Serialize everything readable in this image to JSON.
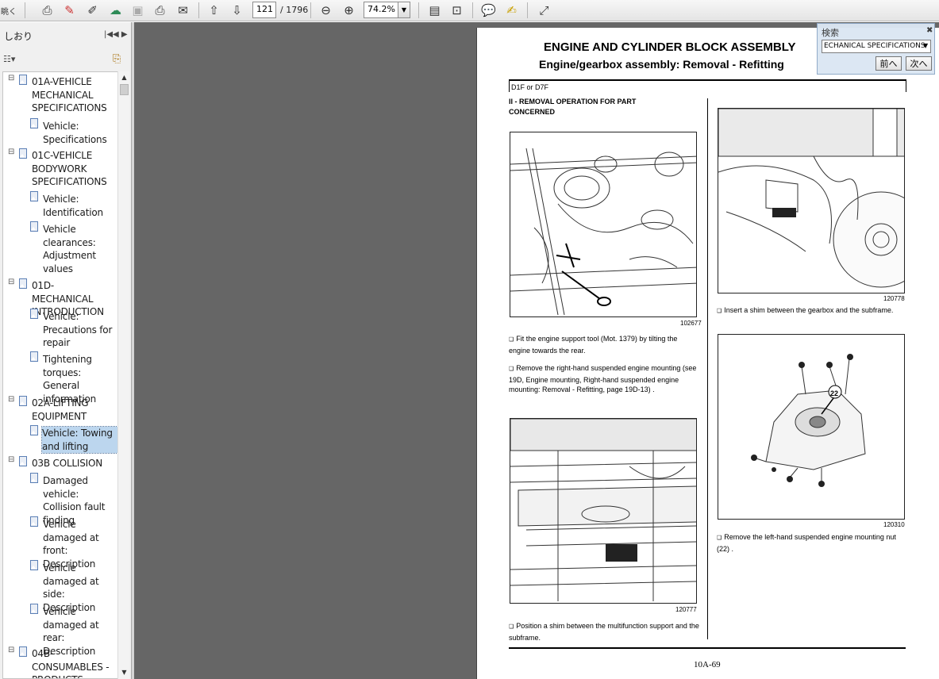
{
  "toolbar": {
    "page_current": "121",
    "page_total": "/ 1796",
    "zoom": "74.2%"
  },
  "sidebar": {
    "title": "しおり",
    "controls": "|◀◀ ▶",
    "items": [
      {
        "label": "01A-VEHICLE MECHANICAL SPECIFICATIONS"
      },
      {
        "label": "Vehicle: Specifications"
      },
      {
        "label": "01C-VEHICLE BODYWORK SPECIFICATIONS"
      },
      {
        "label": "Vehicle: Identification"
      },
      {
        "label": "Vehicle clearances: Adjustment values"
      },
      {
        "label": "01D-MECHANICAL INTRODUCTION"
      },
      {
        "label": "Vehicle: Precautions for repair"
      },
      {
        "label": "Tightening torques: General information"
      },
      {
        "label": "02A-LIFTING EQUIPMENT"
      },
      {
        "label": "Vehicle: Towing and lifting"
      },
      {
        "label": "03B COLLISION"
      },
      {
        "label": "Damaged vehicle: Collision fault finding"
      },
      {
        "label": "Vehicle damaged at front: Description"
      },
      {
        "label": "Vehicle damaged at side: Description"
      },
      {
        "label": "Vehicle damaged at rear: Description"
      },
      {
        "label": "04B-CONSUMABLES - PRODUCTS"
      }
    ]
  },
  "page": {
    "title": "ENGINE AND CYLINDER BLOCK ASSEMBLY",
    "subtitle": "Engine/gearbox assembly: Removal - Refitting",
    "engine_code": "D1F or D7F",
    "section_heading": "II - REMOVAL OPERATION FOR PART CONCERNED",
    "step1": "Fit the engine support tool (Mot. 1379) by tilting the engine towards the rear.",
    "step2": "Remove the right-hand suspended engine mounting (see 19D, Engine mounting, Right-hand suspended engine mounting: Removal - Refitting, page 19D-13) .",
    "step3": "Position a shim between the multifunction support and the subframe.",
    "step4": "Insert a shim between the gearbox and the subframe.",
    "step5": "Remove the left-hand suspended engine mounting nut (22) .",
    "fig1_num": "102677",
    "fig2_num": "120777",
    "fig3_num": "120778",
    "fig4_num": "120310",
    "callout": "22",
    "page_number": "10A-69"
  },
  "search": {
    "title": "検索",
    "query": "ECHANICAL SPECIFICATIONS",
    "prev": "前へ",
    "next": "次へ"
  }
}
